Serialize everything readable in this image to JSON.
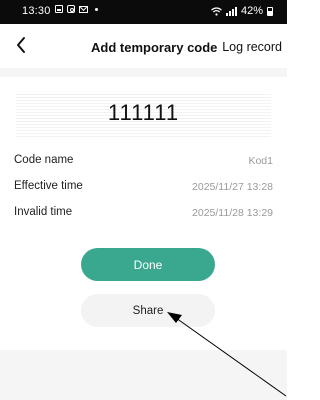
{
  "status_bar": {
    "time": "13:30",
    "battery_text": "42%",
    "icons": [
      "image-icon",
      "instagram-icon",
      "mail-icon",
      "dot-icon",
      "wifi-icon",
      "signal-icon",
      "battery-icon"
    ]
  },
  "nav": {
    "back_icon": "chevron-left-icon",
    "title": "Add temporary code",
    "action_label": "Log record"
  },
  "code": {
    "value": "111111"
  },
  "details": [
    {
      "label": "Code name",
      "value": "Kod1"
    },
    {
      "label": "Effective time",
      "value": "2025/11/27 13:28"
    },
    {
      "label": "Invalid time",
      "value": "2025/11/28 13:29"
    }
  ],
  "buttons": {
    "done_label": "Done",
    "share_label": "Share"
  },
  "colors": {
    "accent": "#3aa88f",
    "status_bar": "#0b0b0b",
    "secondary_text": "#9a9a9a",
    "annotation_arrow": "#000000"
  }
}
